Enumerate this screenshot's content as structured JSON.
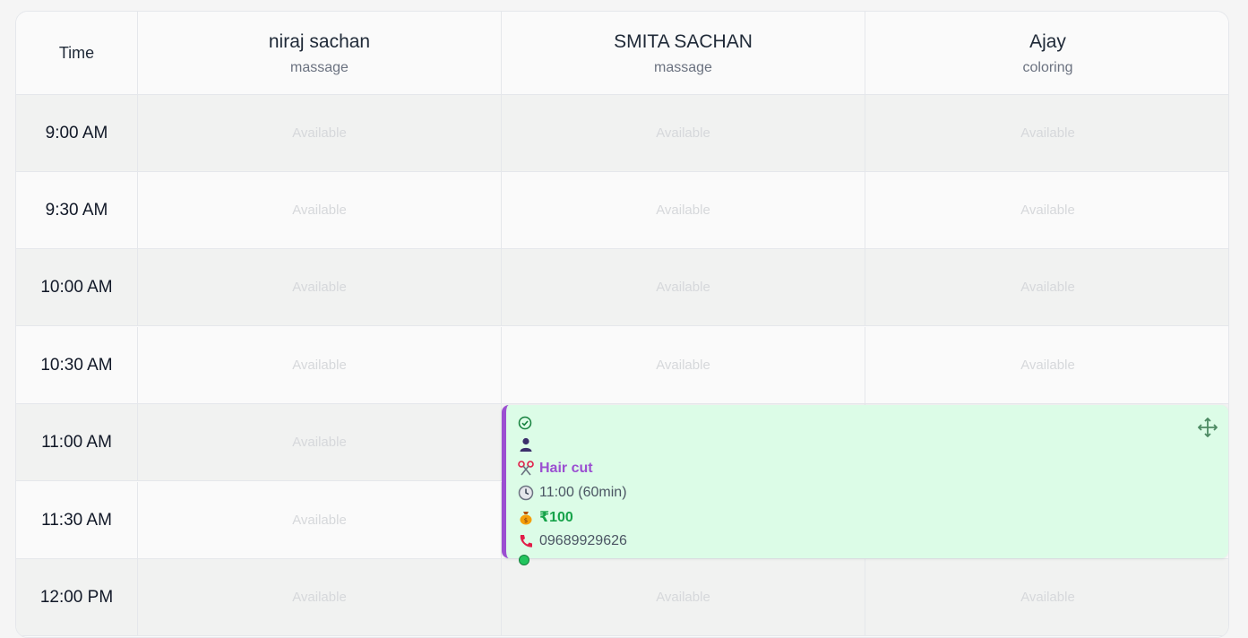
{
  "header": {
    "time_label": "Time",
    "staff": [
      {
        "name": "niraj sachan",
        "service": "massage"
      },
      {
        "name": "SMITA SACHAN",
        "service": "massage"
      },
      {
        "name": "Ajay",
        "service": "coloring"
      }
    ]
  },
  "slots": [
    {
      "time": "9:00 AM",
      "cells": [
        "Available",
        "Available",
        "Available"
      ]
    },
    {
      "time": "9:30 AM",
      "cells": [
        "Available",
        "Available",
        "Available"
      ]
    },
    {
      "time": "10:00 AM",
      "cells": [
        "Available",
        "Available",
        "Available"
      ]
    },
    {
      "time": "10:30 AM",
      "cells": [
        "Available",
        "Available",
        "Available"
      ]
    },
    {
      "time": "11:00 AM",
      "cells": [
        "Available",
        "",
        ""
      ]
    },
    {
      "time": "11:30 AM",
      "cells": [
        "Available",
        "",
        ""
      ]
    },
    {
      "time": "12:00 PM",
      "cells": [
        "Available",
        "Available",
        "Available"
      ]
    }
  ],
  "appointment": {
    "service": "Hair cut",
    "time": "11:00 (60min)",
    "price": "₹100",
    "phone": "09689929626",
    "icons": [
      "check-circle-icon",
      "person-icon",
      "scissors-icon",
      "clock-icon",
      "money-bag-icon",
      "phone-icon",
      "move-icon"
    ],
    "colors": {
      "accent": "#9b4fd1",
      "background": "#dcfce7",
      "price": "#16a34a"
    }
  }
}
